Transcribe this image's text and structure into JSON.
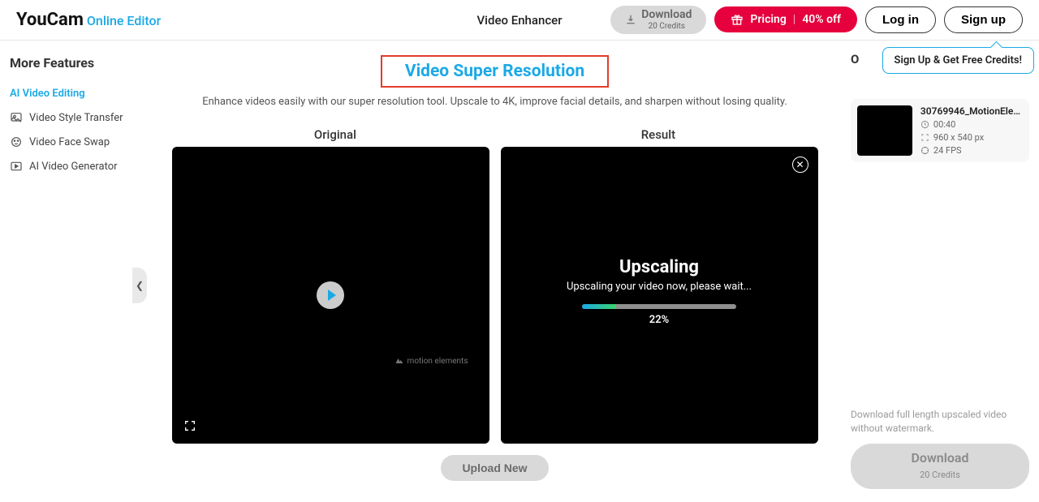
{
  "header": {
    "logo_main": "YouCam",
    "logo_sub": "Online Editor",
    "page_title": "Video Enhancer",
    "download_label": "Download",
    "download_sub": "20 Credits",
    "pricing_label": "Pricing",
    "pricing_discount": "40% off",
    "login": "Log in",
    "signup": "Sign up"
  },
  "sidebar": {
    "title": "More Features",
    "items": [
      {
        "label": "AI Video Editing"
      },
      {
        "label": "Video Style Transfer"
      },
      {
        "label": "Video Face Swap"
      },
      {
        "label": "AI Video Generator"
      }
    ]
  },
  "center": {
    "title": "Video Super Resolution",
    "subtitle": "Enhance videos easily with our super resolution tool. Upscale to 4K, improve facial details, and sharpen without losing quality.",
    "original_label": "Original",
    "result_label": "Result",
    "watermark": "motion elements",
    "upscaling_title": "Upscaling",
    "upscaling_sub": "Upscaling your video now, please wait...",
    "progress_pct": "22%",
    "upload_new": "Upload New"
  },
  "right": {
    "section_letter": "O",
    "tooltip": "Sign Up & Get Free Credits!",
    "video": {
      "name": "30769946_MotionElem…",
      "duration": "00:40",
      "dimensions": "960 x 540 px",
      "fps": "24 FPS"
    },
    "download_note": "Download full length upscaled video without watermark.",
    "download_label": "Download",
    "download_sub": "20 Credits"
  }
}
